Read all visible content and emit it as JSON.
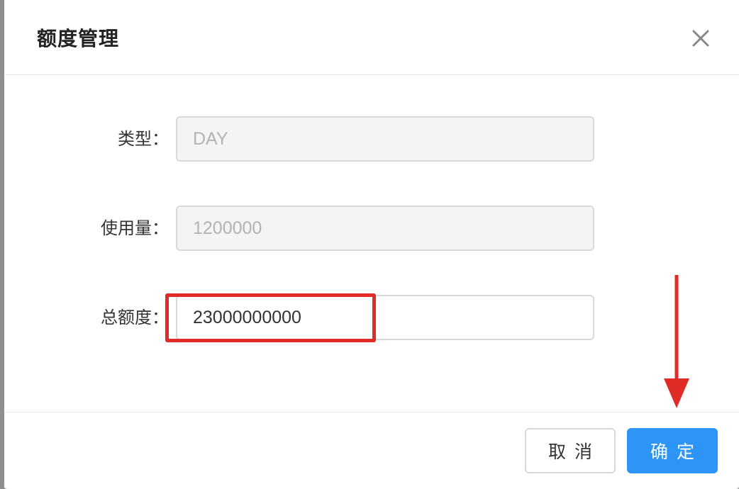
{
  "dialog": {
    "title": "额度管理"
  },
  "form": {
    "type_label": "类型：",
    "type_value": "DAY",
    "usage_label": "使用量：",
    "usage_value": "1200000",
    "total_label": "总额度：",
    "total_value": "23000000000"
  },
  "footer": {
    "cancel_label": "取消",
    "ok_label": "确定"
  },
  "colors": {
    "primary": "#2d95f5",
    "annotation": "#e02b27"
  }
}
